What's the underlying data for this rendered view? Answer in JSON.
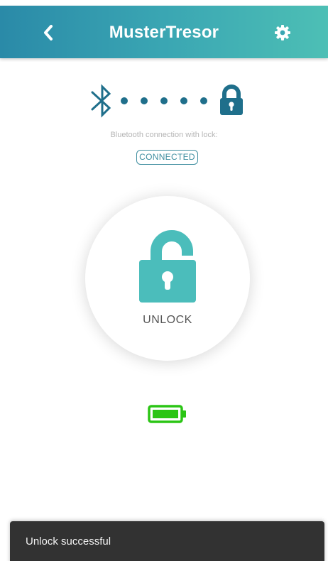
{
  "header": {
    "title": "MusterTresor",
    "back_icon": "chevron-left-icon",
    "settings_icon": "gear-icon"
  },
  "connection": {
    "bluetooth_icon": "bluetooth-icon",
    "lock_icon": "lock-closed-icon",
    "label": "Bluetooth connection with lock:",
    "status": "CONNECTED"
  },
  "unlock": {
    "label": "UNLOCK",
    "icon": "lock-open-icon"
  },
  "battery": {
    "icon": "battery-full-icon",
    "level": 1.0
  },
  "snackbar": {
    "message": "Unlock successful"
  },
  "colors": {
    "header_start": "#2a8aa8",
    "header_end": "#4dbfb5",
    "teal": "#4bbdbb",
    "dark_teal": "#1f6f8b",
    "battery_green": "#2bc515",
    "snackbar_bg": "#323232"
  }
}
